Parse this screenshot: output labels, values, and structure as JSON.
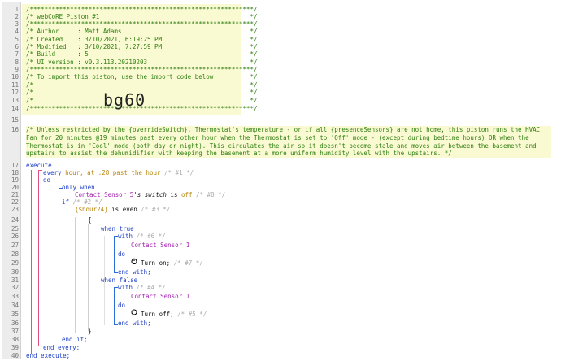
{
  "header_lines": [
    "/*************************************************************/",
    "/* webCoRE Piston #1                                         */",
    "/*************************************************************/",
    "/* Author     : Matt Adams                                   */",
    "/* Created    : 3/10/2021, 6:19:25 PM                        */",
    "/* Modified   : 3/10/2021, 7:27:59 PM                        */",
    "/* Build      : 5                                            */",
    "/* UI version : v0.3.113.20210203                            */",
    "/*************************************************************/",
    "/* To import this piston, use the import code below:         */",
    "/*                                                           */",
    "/*                                                           */",
    "/*                                                           */",
    "/*************************************************************/"
  ],
  "import_code": "bg60",
  "description_comment": "/* Unless restricted by the {overrideSwitch}, Thermostat's temperature - or if all {presenceSensors} are not home, this piston runs the HVAC Fan for 20 minutes @19 minutes past every other hour when the Thermostat is set to 'Off' mode - (except during bedtime hours) OR when the Thermostat is in 'Cool' mode (both day or night). This circulates the air so it doesn't become stale and moves air between the basement and upstairs to assist the dehumidifier with keeping the basement at a more uniform humidity level with the upstairs. */",
  "line_numbers": [
    "1",
    "2",
    "3",
    "4",
    "5",
    "6",
    "7",
    "8",
    "9",
    "10",
    "11",
    "12",
    "13",
    "14",
    "15",
    "16",
    "17",
    "18",
    "19",
    "20",
    "21",
    "22",
    "23",
    "24",
    "25",
    "26",
    "27",
    "28",
    "29",
    "30",
    "31",
    "32",
    "33",
    "34",
    "35",
    "36",
    "37",
    "38",
    "39",
    "40"
  ],
  "code": {
    "execute": "execute",
    "every": "every",
    "hour_at": "hour, at",
    "minute": ":28",
    "past_the_hour": "past the hour",
    "c1": "/* #1 */",
    "do": "do",
    "only_when": "only when",
    "contact_sensor_5": "Contact Sensor 5",
    "s_switch": "'s switch",
    "is": "is",
    "off": "off",
    "c8": "/* #8 */",
    "if": "if",
    "c2": "/* #2 */",
    "hour24": "{$hour24}",
    "is_even": "is even",
    "c3": "/* #3 */",
    "brace_open": "{",
    "when_true": "when true",
    "with": "with",
    "c6": "/* #6 */",
    "contact_sensor_1": "Contact Sensor 1",
    "do2": "do",
    "turn_on": "Turn on;",
    "c7": "/* #7 */",
    "end_with": "end with;",
    "when_false": "when false",
    "c4": "/* #4 */",
    "contact_sensor_1b": "Contact Sensor 1",
    "do3": "do",
    "turn_off": "Turn off;",
    "c5": "/* #5 */",
    "end_with2": "end with;",
    "brace_close": "}",
    "end_if": "end if;",
    "end_every": "end every;",
    "end_execute": "end execute;"
  },
  "colors": {
    "comment": "#2e7d10",
    "keyword": "#2040c8",
    "device": "#a41cb0",
    "variable": "#b8860b",
    "highlight": "#fafad2"
  },
  "icons": [
    "power-on-icon",
    "power-off-icon"
  ]
}
